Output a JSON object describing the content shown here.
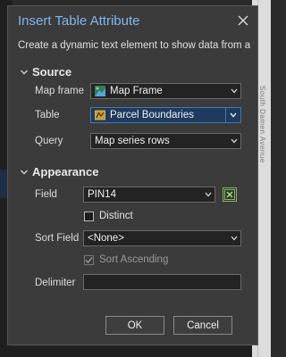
{
  "dialog": {
    "title": "Insert Table Attribute",
    "description": "Create a dynamic text element to show data from a table."
  },
  "source": {
    "heading": "Source",
    "map_frame_label": "Map frame",
    "map_frame_value": "Map Frame",
    "table_label": "Table",
    "table_value": "Parcel Boundaries",
    "query_label": "Query",
    "query_value": "Map series rows"
  },
  "appearance": {
    "heading": "Appearance",
    "field_label": "Field",
    "field_value": "PIN14",
    "distinct_label": "Distinct",
    "distinct_checked": false,
    "sort_field_label": "Sort Field",
    "sort_field_value": "<None>",
    "sort_ascending_label": "Sort Ascending",
    "sort_ascending_checked": true,
    "sort_ascending_enabled": false,
    "delimiter_label": "Delimiter",
    "delimiter_value": ""
  },
  "buttons": {
    "ok": "OK",
    "cancel": "Cancel"
  },
  "background": {
    "map_text": "South Damen Avenue"
  },
  "colors": {
    "title": "#7fb6ee",
    "dialog_bg": "#3b3b3b",
    "selected_combo": "#1f3a5f",
    "field_button_accent": "#8ab46a"
  }
}
